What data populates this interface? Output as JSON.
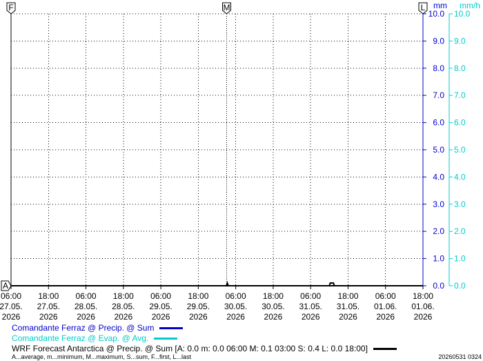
{
  "chart_data": {
    "type": "line",
    "y_units": {
      "left": "mm",
      "right": "mm/h"
    },
    "ylim": [
      0,
      10
    ],
    "y_ticks": [
      "0.0",
      "1.0",
      "2.0",
      "3.0",
      "4.0",
      "5.0",
      "6.0",
      "7.0",
      "8.0",
      "9.0",
      "10.0"
    ],
    "x_ticks": [
      {
        "time": "06:00",
        "date": "27.05.",
        "year": "2026"
      },
      {
        "time": "18:00",
        "date": "27.05.",
        "year": "2026"
      },
      {
        "time": "06:00",
        "date": "28.05.",
        "year": "2026"
      },
      {
        "time": "18:00",
        "date": "28.05.",
        "year": "2026"
      },
      {
        "time": "06:00",
        "date": "29.05.",
        "year": "2026"
      },
      {
        "time": "18:00",
        "date": "29.05.",
        "year": "2026"
      },
      {
        "time": "06:00",
        "date": "30.05.",
        "year": "2026"
      },
      {
        "time": "18:00",
        "date": "30.05.",
        "year": "2026"
      },
      {
        "time": "06:00",
        "date": "31.05.",
        "year": "2026"
      },
      {
        "time": "18:00",
        "date": "31.05.",
        "year": "2026"
      },
      {
        "time": "06:00",
        "date": "01.06.",
        "year": "2026"
      },
      {
        "time": "18:00",
        "date": "01.06.",
        "year": "2026"
      }
    ],
    "markers": {
      "top_left": "F",
      "top_middle": "M",
      "top_right": "L",
      "bottom_left": "A"
    },
    "series": [
      {
        "name": "Comandante Ferraz @ Precip. @ Sum",
        "color": "#0000cc",
        "points": []
      },
      {
        "name": "Comandante Ferraz @ Evap. @ Avg.",
        "color": "#00cccc",
        "points": []
      },
      {
        "name": "WRF Forecast Antarctica @ Precip. @ Sum [A: 0.0 m: 0.0 06:00 M: 0.1 03:00 S: 0.4 L: 0.0 18:00]",
        "color": "#000000",
        "points_x_hours_from_start": [
          0,
          69,
          69.3,
          69.6,
          102,
          102.3,
          102.6,
          103,
          103.3,
          103.6,
          132
        ],
        "points_y": [
          0,
          0,
          0.1,
          0,
          0,
          0.1,
          0.1,
          0.1,
          0.1,
          0,
          0
        ]
      }
    ]
  },
  "legend": [
    {
      "label": "Comandante Ferraz @ Precip. @ Sum",
      "color": "#0000cc"
    },
    {
      "label": "Comandante Ferraz @ Evap. @ Avg.",
      "color": "#00cccc"
    },
    {
      "label": "WRF Forecast Antarctica @ Precip. @ Sum [A: 0.0 m: 0.0 06:00 M: 0.1 03:00 S: 0.4 L: 0.0 18:00]",
      "color": "#000000"
    }
  ],
  "footnote": {
    "abbreviations": "A...average, m...minimum, M...maximum, S...sum, F...first, L...last",
    "timestamp": "20260531 0324"
  },
  "colors": {
    "left_axis": "#0000cc",
    "right_axis": "#00cccc",
    "grid": "#000000"
  }
}
